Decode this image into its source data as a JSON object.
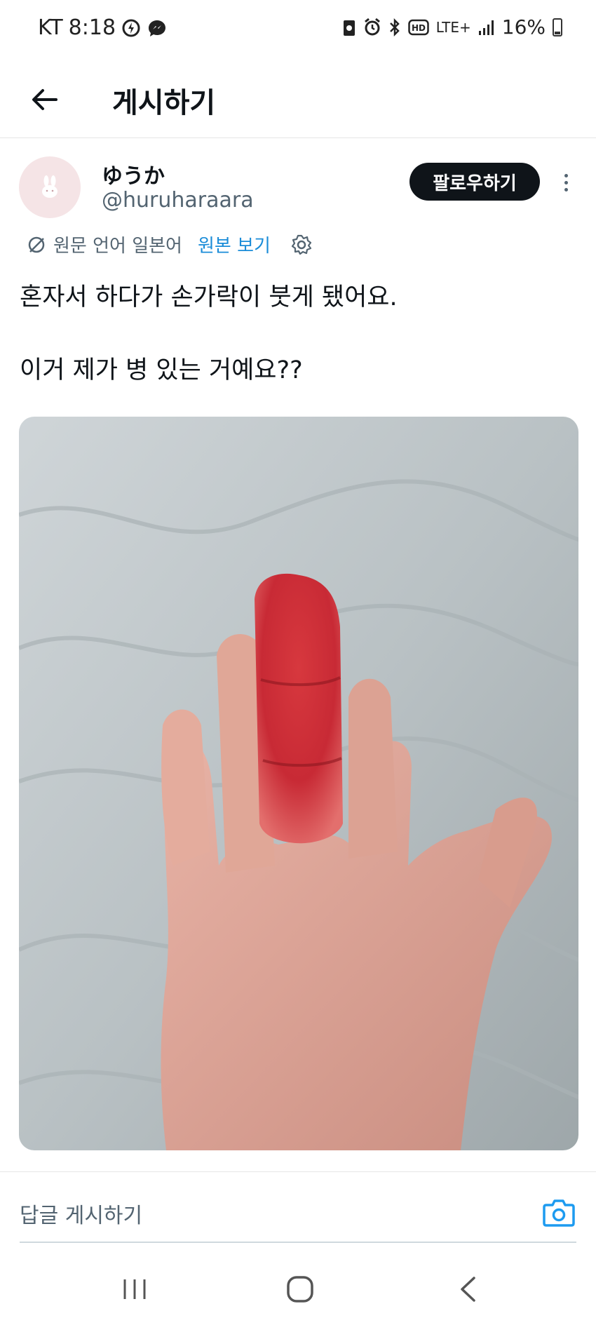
{
  "status_bar": {
    "carrier": "KT",
    "time": "8:18",
    "network": "LTE+",
    "battery": "16%"
  },
  "header": {
    "title": "게시하기"
  },
  "post": {
    "author": {
      "display_name": "ゆうか",
      "handle": "@huruharaara"
    },
    "follow_label": "팔로우하기",
    "translation": {
      "note": "원문 언어 일본어",
      "view_original": "원본 보기"
    },
    "text": {
      "line1": "혼자서 하다가 손가락이 붓게 됐어요.",
      "line2": "이거 제가 병 있는 거예요??"
    }
  },
  "reply": {
    "placeholder": "답글 게시하기"
  },
  "icons": {
    "back": "arrow-left-icon",
    "more": "more-vertical-icon",
    "translate": "translate-off-icon",
    "settings": "gear-icon",
    "camera": "camera-icon"
  },
  "colors": {
    "accent": "#1d9bf0",
    "text": "#0f1419",
    "secondary": "#536471"
  }
}
